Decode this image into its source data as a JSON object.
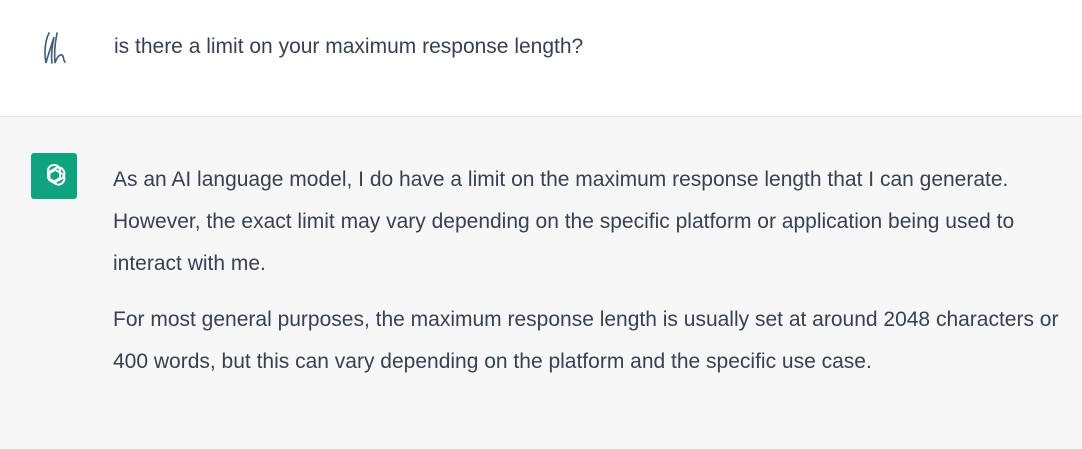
{
  "user_message": {
    "text": "is there a limit on your maximum response length?"
  },
  "assistant_message": {
    "paragraphs": [
      "As an AI language model, I do have a limit on the maximum response length that I can generate. However, the exact limit may vary depending on the specific platform or application being used to interact with me.",
      "For most general purposes, the maximum response length is usually set at around 2048 characters or 400 words, but this can vary depending on the platform and the specific use case."
    ]
  },
  "colors": {
    "assistant_background": "#f7f7f8",
    "bot_avatar": "#10a37f",
    "text": "#374151"
  },
  "icons": {
    "user_avatar": "user-monogram-icon",
    "bot_avatar": "openai-logo-icon"
  }
}
